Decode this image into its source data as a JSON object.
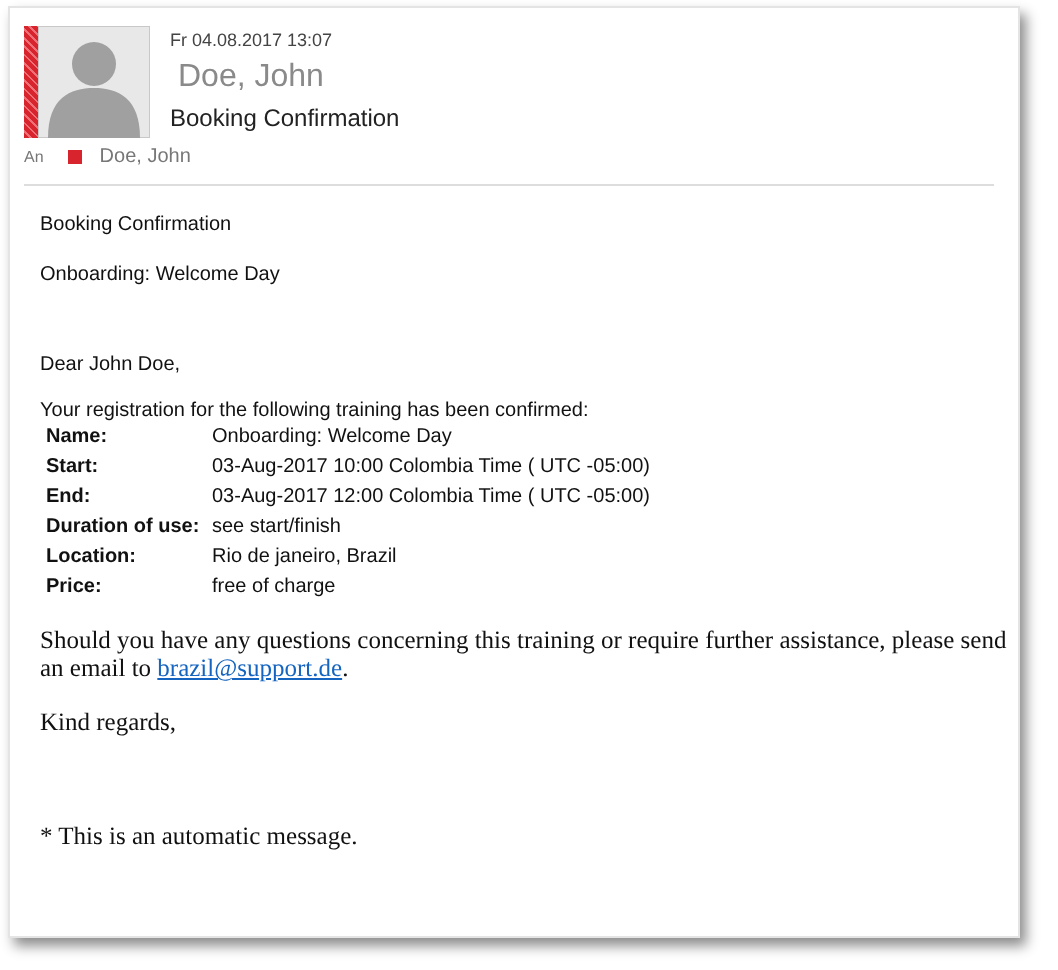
{
  "header": {
    "date": "Fr 04.08.2017 13:07",
    "sender": "Doe, John",
    "subject": "Booking Confirmation",
    "to_label": "An",
    "recipient": "Doe, John"
  },
  "body": {
    "lines": [
      "Booking Confirmation",
      "Onboarding: Welcome Day"
    ],
    "greeting": "Dear John Doe,",
    "intro": "Your registration for the following training has been confirmed:",
    "details": [
      {
        "label": "Name:",
        "value": "Onboarding: Welcome Day"
      },
      {
        "label": "Start:",
        "value": "03-Aug-2017 10:00 Colombia Time ( UTC -05:00)"
      },
      {
        "label": "End:",
        "value": "03-Aug-2017 12:00 Colombia Time ( UTC -05:00)"
      },
      {
        "label": "Duration of use:",
        "value": "see start/finish"
      },
      {
        "label": "Location:",
        "value": "Rio de janeiro, Brazil"
      },
      {
        "label": "Price:",
        "value": "free of charge"
      }
    ],
    "contact_text": "Should you have any questions concerning this training or require further assistance, please send an email to",
    "contact_link": "brazil@support.de",
    "contact_end": ".",
    "closing": "Kind regards,",
    "footnote": "* This is an automatic message."
  }
}
